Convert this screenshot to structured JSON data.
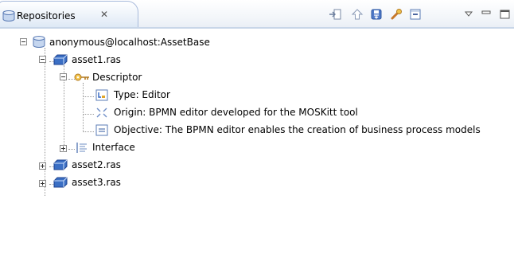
{
  "view": {
    "title": "Repositories",
    "close_glyph": "✕",
    "tab_icon": "repository-icon"
  },
  "toolbar": {
    "icons": [
      "import-icon",
      "up-arrow-icon",
      "save-icon",
      "key-icon",
      "collapse-all-icon",
      "view-menu-icon",
      "minimize-icon",
      "maximize-icon"
    ]
  },
  "tree": {
    "root": {
      "label": "anonymous@localhost:AssetBase",
      "icon": "repository-icon",
      "expanded": true
    },
    "asset1": {
      "label": "asset1.ras",
      "icon": "asset-icon",
      "expanded": true
    },
    "descriptor": {
      "label": "Descriptor",
      "icon": "key-icon",
      "expanded": true
    },
    "type": {
      "label": "Type: Editor",
      "icon": "type-icon"
    },
    "origin": {
      "label": "Origin: BPMN editor developed for the MOSKitt tool",
      "icon": "origin-icon"
    },
    "objective": {
      "label": "Objective: The BPMN editor enables the creation of business process models",
      "icon": "objective-icon"
    },
    "interface": {
      "label": "Interface",
      "icon": "interface-icon",
      "expanded": false
    },
    "asset2": {
      "label": "asset2.ras",
      "icon": "asset-icon",
      "expanded": false
    },
    "asset3": {
      "label": "asset3.ras",
      "icon": "asset-icon",
      "expanded": false
    }
  },
  "colors": {
    "header_border": "#a7badb",
    "asset_blue": "#3b6fc4",
    "key_gold": "#e0a62a"
  }
}
